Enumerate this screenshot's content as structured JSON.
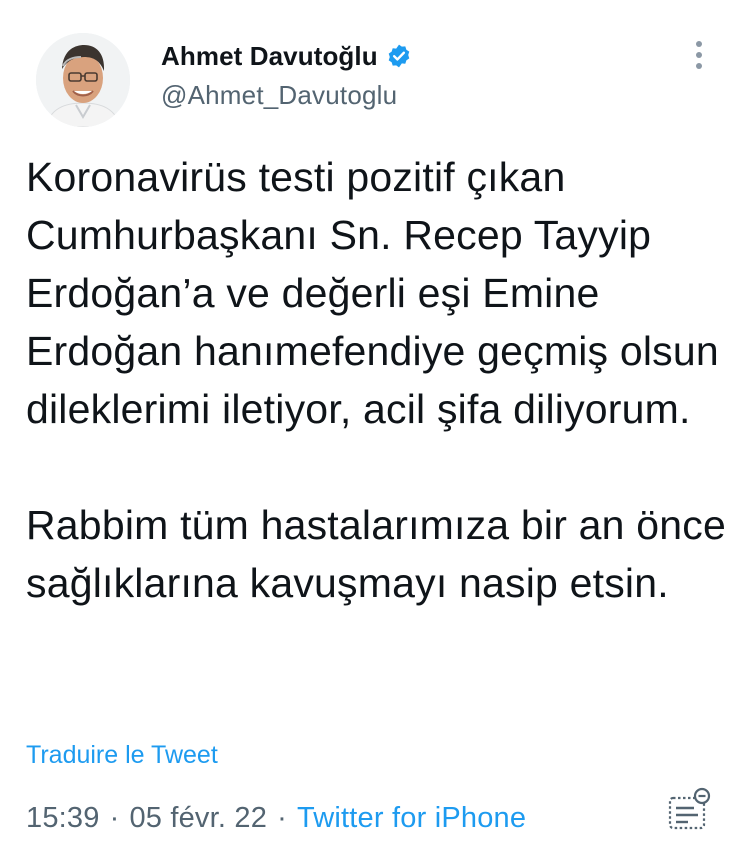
{
  "author": {
    "name": "Ahmet Davutoğlu",
    "handle": "@Ahmet_Davutoglu",
    "verified": true,
    "avatar_icon": "person-avatar"
  },
  "tweet": {
    "paragraphs": [
      "Koronavirüs testi pozitif çıkan Cumhurbaşkanı Sn. Recep Tayyip Erdoğan’a ve değerli eşi Emine Erdoğan hanımefendiye geçmiş olsun dileklerimi iletiyor, acil şifa diliyorum.",
      "Rabbim tüm hastalarımıza bir an önce sağlıklarına kavuşmayı nasip etsin."
    ],
    "translate_label": "Traduire le Tweet"
  },
  "meta": {
    "time": "15:39",
    "separator": "·",
    "date": "05 févr. 22",
    "source": "Twitter for iPhone"
  },
  "icons": {
    "more": "more-vertical-icon",
    "verified": "verified-badge-icon",
    "analytics": "analytics-icon"
  },
  "colors": {
    "accent": "#1d9bf0",
    "text": "#0f1419",
    "secondary": "#536471"
  }
}
